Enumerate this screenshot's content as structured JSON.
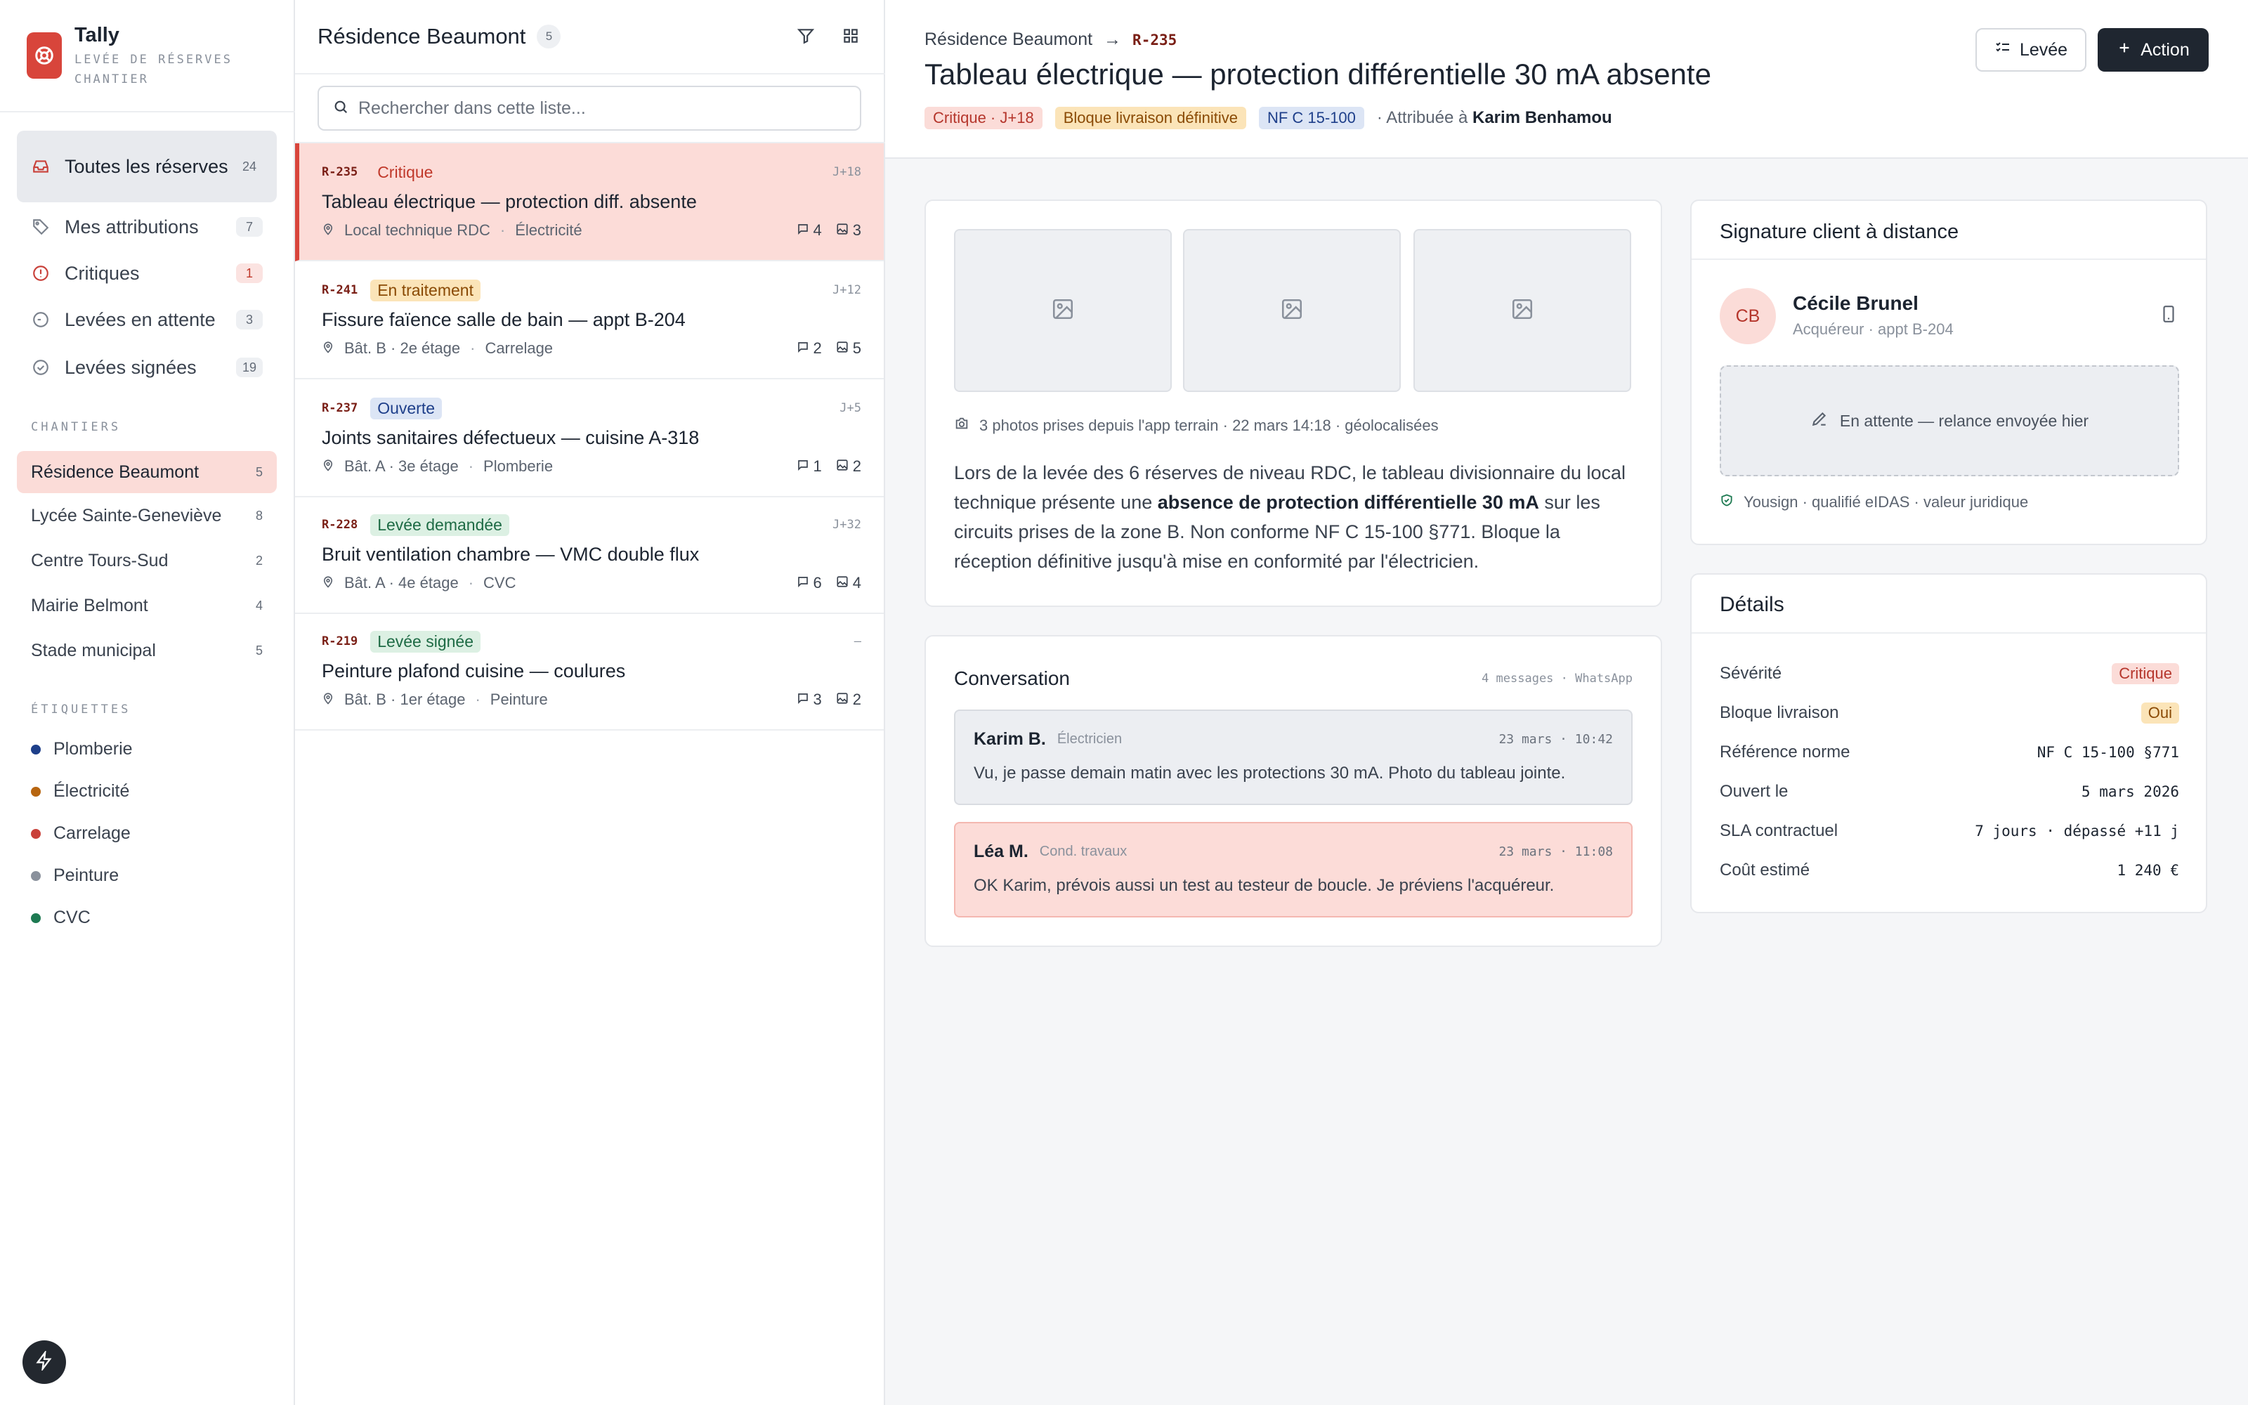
{
  "app": {
    "name": "Tally",
    "subtitle": "LEVÉE DE RÉSERVES CHANTIER"
  },
  "sidebar": {
    "nav": [
      {
        "label": "Toutes les réserves",
        "count": "24",
        "icon": "inbox-icon"
      },
      {
        "label": "Mes attributions",
        "count": "7",
        "icon": "tag-icon"
      },
      {
        "label": "Critiques",
        "count": "1",
        "icon": "alert-circle-icon"
      },
      {
        "label": "Levées en attente",
        "count": "3",
        "icon": "clock-icon"
      },
      {
        "label": "Levées signées",
        "count": "19",
        "icon": "check-circle-icon"
      }
    ],
    "sites_title": "CHANTIERS",
    "sites": [
      {
        "label": "Résidence Beaumont",
        "count": "5"
      },
      {
        "label": "Lycée Sainte-Geneviève",
        "count": "8"
      },
      {
        "label": "Centre Tours-Sud",
        "count": "2"
      },
      {
        "label": "Mairie Belmont",
        "count": "4"
      },
      {
        "label": "Stade municipal",
        "count": "5"
      }
    ],
    "tags_title": "ÉTIQUETTES",
    "tags": [
      {
        "label": "Plomberie",
        "color": "#1e3f8a"
      },
      {
        "label": "Électricité",
        "color": "#b7650f"
      },
      {
        "label": "Carrelage",
        "color": "#c9413a"
      },
      {
        "label": "Peinture",
        "color": "#8a919c"
      },
      {
        "label": "CVC",
        "color": "#1e7a52"
      }
    ]
  },
  "list": {
    "title": "Résidence Beaumont",
    "count": "5",
    "search_placeholder": "Rechercher dans cette liste...",
    "items": [
      {
        "ref": "R-235",
        "status": "Critique",
        "jdays": "J+18",
        "title": "Tableau électrique — protection diff. absente",
        "location": "Local technique RDC",
        "category": "Électricité",
        "comments": "4",
        "photos": "3"
      },
      {
        "ref": "R-241",
        "status": "En traitement",
        "jdays": "J+12",
        "title": "Fissure faïence salle de bain — appt B-204",
        "location": "Bât. B · 2e étage",
        "category": "Carrelage",
        "comments": "2",
        "photos": "5"
      },
      {
        "ref": "R-237",
        "status": "Ouverte",
        "jdays": "J+5",
        "title": "Joints sanitaires défectueux — cuisine A-318",
        "location": "Bât. A · 3e étage",
        "category": "Plomberie",
        "comments": "1",
        "photos": "2"
      },
      {
        "ref": "R-228",
        "status": "Levée demandée",
        "jdays": "J+32",
        "title": "Bruit ventilation chambre — VMC double flux",
        "location": "Bât. A · 4e étage",
        "category": "CVC",
        "comments": "6",
        "photos": "4"
      },
      {
        "ref": "R-219",
        "status": "Levée signée",
        "jdays": "–",
        "title": "Peinture plafond cuisine — coulures",
        "location": "Bât. B · 1er étage",
        "category": "Peinture",
        "comments": "3",
        "photos": "2"
      }
    ]
  },
  "detail": {
    "crumb_site": "Résidence Beaumont",
    "crumb_ref": "R-235",
    "title": "Tableau électrique — protection différentielle 30 mA absente",
    "chips": [
      "Critique · J+18",
      "Bloque livraison définitive",
      "NF C 15-100"
    ],
    "assigned_prefix": "· Attribuée à",
    "assigned_to": "Karim Benhamou",
    "btn_leve": "Levée",
    "btn_action": "Action",
    "photo_meta": "3 photos prises depuis l'app terrain · 22 mars 14:18 · géolocalisées",
    "desc_before": "Lors de la levée des 6 réserves de niveau RDC, le tableau divisionnaire du local technique présente une ",
    "desc_bold": "absence de protection différentielle 30 mA",
    "desc_after": " sur les circuits prises de la zone B. Non conforme NF C 15-100 §771. Bloque la réception définitive jusqu'à mise en conformité par l'électricien.",
    "conversation": {
      "title": "Conversation",
      "meta": "4 messages · WhatsApp",
      "messages": [
        {
          "author": "Karim B.",
          "role": "Électricien",
          "time": "23 mars · 10:42",
          "text": "Vu, je passe demain matin avec les protections 30 mA. Photo du tableau jointe."
        },
        {
          "author": "Léa M.",
          "role": "Cond. travaux",
          "time": "23 mars · 11:08",
          "text": "OK Karim, prévois aussi un test au testeur de boucle. Je préviens l'acquéreur."
        }
      ]
    },
    "signature": {
      "title": "Signature client à distance",
      "initials": "CB",
      "name": "Cécile Brunel",
      "role": "Acquéreur · appt B-204",
      "status": "En attente — relance envoyée hier",
      "footer": "Yousign · qualifié eIDAS · valeur juridique"
    },
    "details": {
      "title": "Détails",
      "rows": [
        {
          "label": "Sévérité",
          "value": "Critique"
        },
        {
          "label": "Bloque livraison",
          "value": "Oui"
        },
        {
          "label": "Référence norme",
          "value": "NF C 15-100 §771"
        },
        {
          "label": "Ouvert le",
          "value": "5 mars 2026"
        },
        {
          "label": "SLA contractuel",
          "value": "7 jours · dépassé +11 j"
        },
        {
          "label": "Coût estimé",
          "value": "1 240 €"
        }
      ]
    }
  }
}
